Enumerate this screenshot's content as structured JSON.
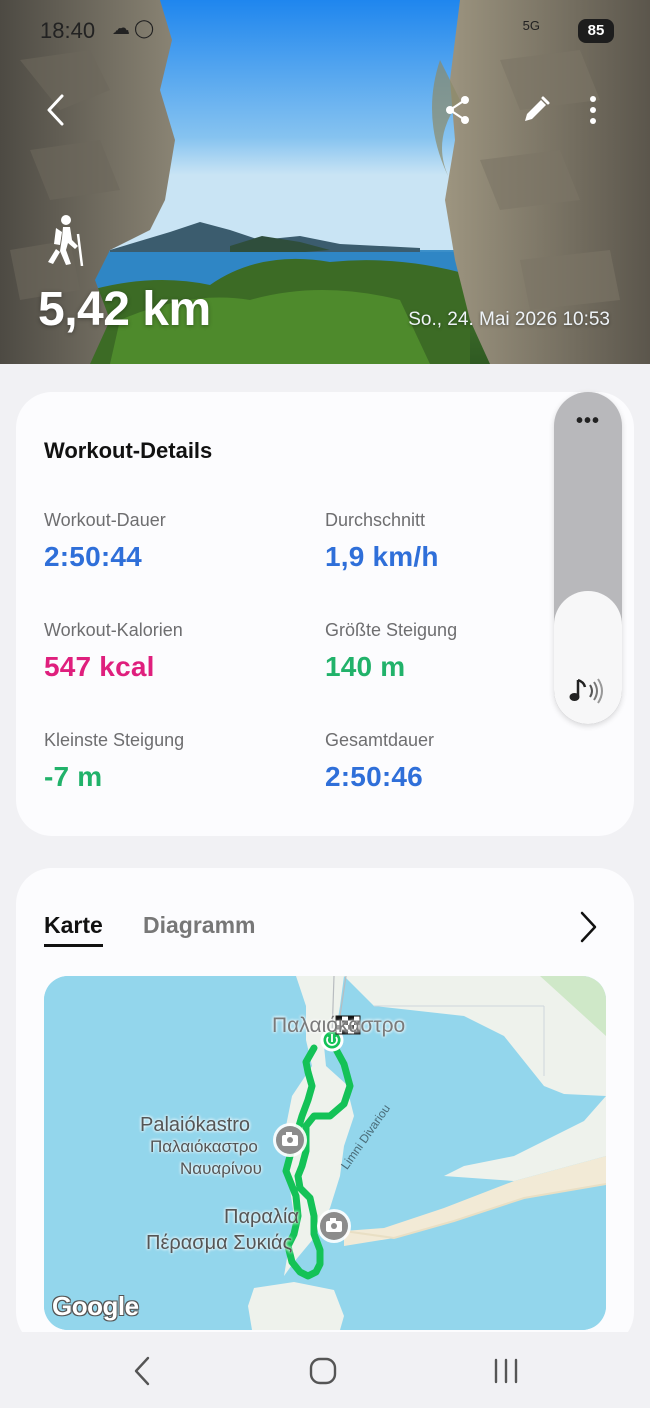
{
  "status_bar": {
    "time": "18:40",
    "notification_icons": [
      "cloud-icon",
      "ring-icon"
    ],
    "network": "5G",
    "battery": "85"
  },
  "header": {
    "back_icon": "chevron-left-icon",
    "actions": [
      "share-icon",
      "edit-icon",
      "more-vertical-icon"
    ],
    "activity_icon": "hiking-icon",
    "distance": "5,42 km",
    "date": "So., 24. Mai 2026 10:53"
  },
  "details": {
    "title": "Workout-Details",
    "metrics": [
      {
        "label": "Workout-Dauer",
        "value": "2:50:44",
        "color": "#2f6fd9"
      },
      {
        "label": "Durchschnitt",
        "value": "1,9 km/h",
        "color": "#2f6fd9"
      },
      {
        "label": "Workout-Kalorien",
        "value": "547 kcal",
        "color": "#df1f7d"
      },
      {
        "label": "Größte Steigung",
        "value": "140 m",
        "color": "#21b26a"
      },
      {
        "label": "Kleinste Steigung",
        "value": "-7 m",
        "color": "#21b26a"
      },
      {
        "label": "Gesamtdauer",
        "value": "2:50:46",
        "color": "#2f6fd9"
      }
    ]
  },
  "volume": {
    "more": "•••",
    "icon": "music-volume-icon",
    "level": 0.4
  },
  "map_section": {
    "tabs": [
      {
        "label": "Karte",
        "active": true
      },
      {
        "label": "Diagramm",
        "active": false
      }
    ],
    "open_icon": "chevron-right-icon",
    "labels": {
      "top_town": "Παλαιόκαστρο",
      "castle_latin": "Palaiókastro",
      "castle_greek_1": "Παλαιόκαστρο",
      "castle_greek_2": "Ναυαρίνου",
      "beach_1": "Παραλία",
      "beach_2": "Πέρασμα Συκιάς",
      "lake": "Limni Divariou"
    },
    "attribution": "Google",
    "route_color": "#14c257"
  },
  "navbar": {
    "buttons": [
      "back-nav-icon",
      "home-nav-icon",
      "recents-nav-icon"
    ]
  }
}
